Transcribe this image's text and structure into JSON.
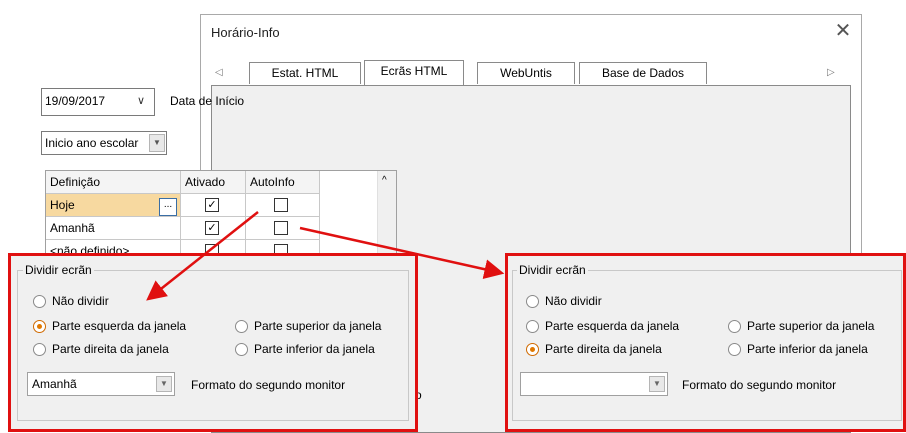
{
  "dialog": {
    "title": "Horário-Info",
    "close_glyph": "✕"
  },
  "tabs": {
    "prev_glyph": "◁",
    "next_glyph": "▷",
    "items": [
      {
        "label": "Estat. HTML"
      },
      {
        "label": "Ecrãs HTML"
      },
      {
        "label": "WebUntis"
      },
      {
        "label": "Base de Dados"
      }
    ],
    "active": "Ecrãs HTML"
  },
  "date": {
    "value": "19/09/2017",
    "label": "Data de Início"
  },
  "period": {
    "value": "Inicio ano escolar"
  },
  "grid": {
    "headers": [
      "Definição",
      "Ativado",
      "AutoInfo"
    ],
    "rows": [
      {
        "name": "Hoje",
        "ativado": true,
        "autoinfo": false
      },
      {
        "name": "Amanhã",
        "ativado": true,
        "autoinfo": false
      },
      {
        "name": "<não definido>",
        "ativado": false,
        "autoinfo": false
      }
    ],
    "dots_label": "...",
    "scroll_up_glyph": "^"
  },
  "partial_text": "o",
  "split_left": {
    "group_title": "Dividir ecrãn",
    "options": {
      "none": "Não dividir",
      "left": "Parte esquerda da janela",
      "top": "Parte superior da janela",
      "right": "Parte direita da janela",
      "bottom": "Parte inferior da janela"
    },
    "selected": "left",
    "monitor_value": "Amanhã",
    "monitor_label": "Formato do segundo monitor"
  },
  "split_right": {
    "group_title": "Dividir ecrãn",
    "options": {
      "none": "Não dividir",
      "left": "Parte esquerda da janela",
      "top": "Parte superior da janela",
      "right": "Parte direita da janela",
      "bottom": "Parte inferior da janela"
    },
    "selected": "right",
    "monitor_value": "",
    "monitor_label": "Formato do segundo monitor"
  },
  "colors": {
    "callout": "#e01010",
    "selected_cell": "#f7d9a0",
    "radio_selected": "#e07800"
  }
}
